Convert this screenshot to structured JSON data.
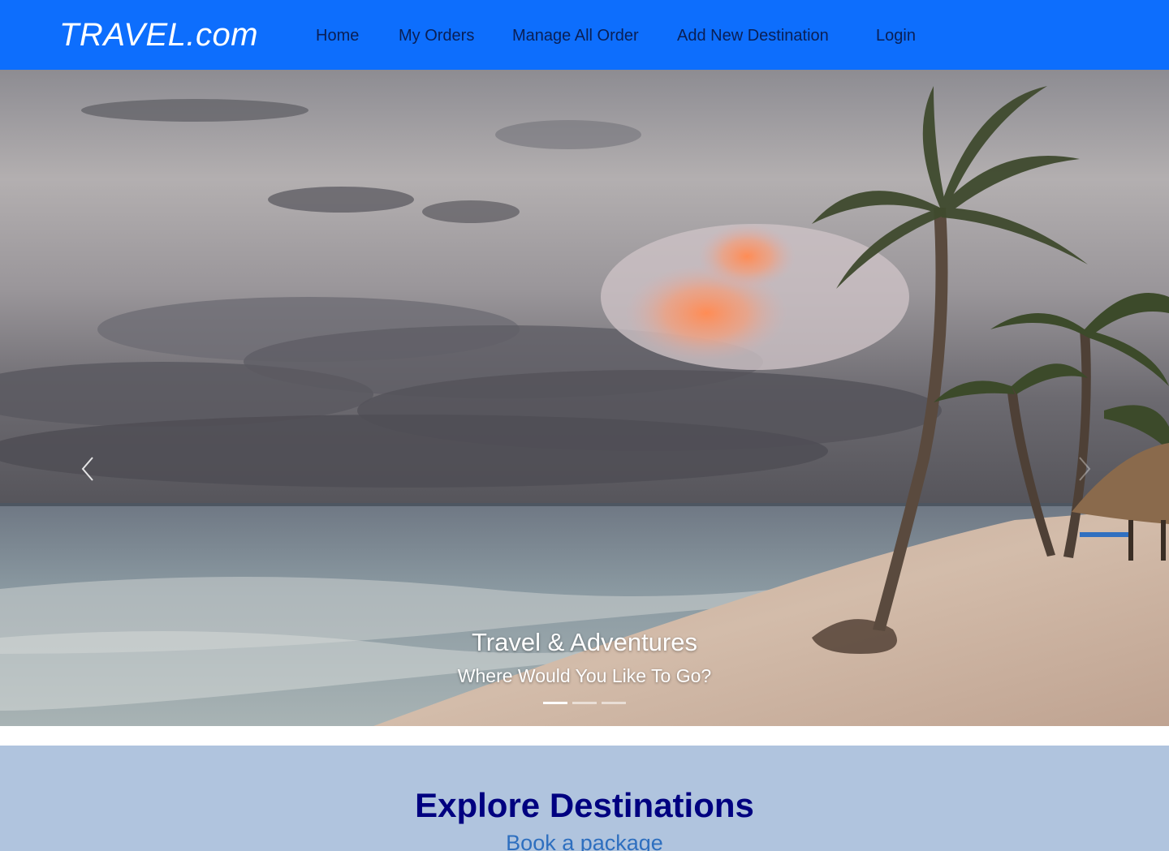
{
  "navbar": {
    "brand": "TRAVEL.com",
    "links": [
      {
        "label": "Home"
      },
      {
        "label": "My Orders"
      },
      {
        "label": "Manage All Order"
      },
      {
        "label": "Add New Destination"
      },
      {
        "label": "Login"
      }
    ],
    "background_color": "#0d6efd"
  },
  "hero": {
    "title": "Travel & Adventures",
    "subtitle": "Where Would You Like To Go?",
    "slide_count": 3,
    "active_slide": 1,
    "prev_icon": "chevron-left-icon",
    "next_icon": "chevron-right-icon"
  },
  "explore": {
    "title": "Explore Destinations",
    "subtitle": "Book a package",
    "background_color": "#b0c4de"
  }
}
